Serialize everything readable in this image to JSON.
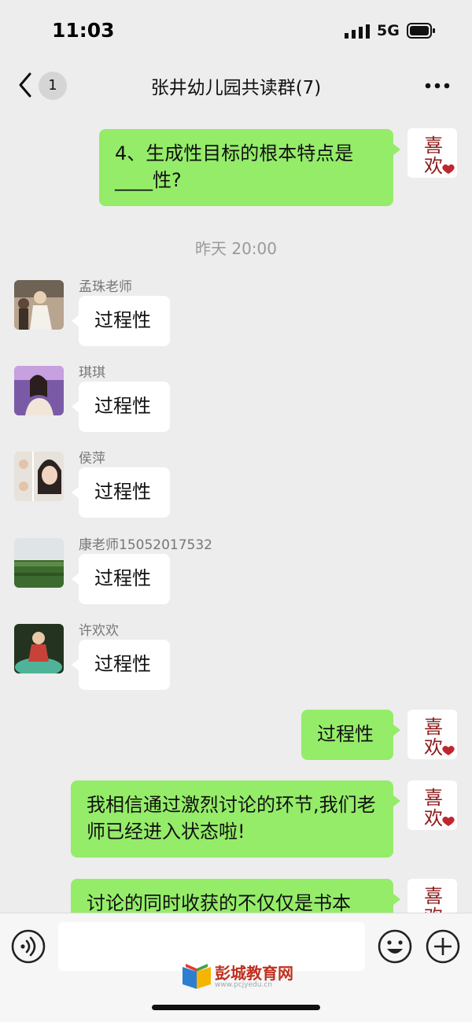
{
  "status_bar": {
    "time": "11:03",
    "network": "5G",
    "icons": [
      "signal-icon",
      "battery-icon"
    ]
  },
  "nav": {
    "back_icon": "chevron-left-icon",
    "unread_count": "1",
    "title": "张井幼儿园共读群(7)",
    "more_icon": "more-icon"
  },
  "messages": {
    "m1": {
      "text": "4、生成性目标的根本特点是____性?"
    },
    "timestamp": "昨天 20:00",
    "m2": {
      "sender": "孟珠老师",
      "text": "过程性"
    },
    "m3": {
      "sender": "琪琪",
      "text": "过程性"
    },
    "m4": {
      "sender": "侯萍",
      "text": "过程性"
    },
    "m5": {
      "sender": "康老师15052017532",
      "text": "过程性"
    },
    "m6": {
      "sender": "许欢欢",
      "text": "过程性"
    },
    "m7": {
      "text": "过程性"
    },
    "m8": {
      "text": "我相信通过激烈讨论的环节,我们老师已经进入状态啦!"
    },
    "m9": {
      "text": "讨论的同时收获的不仅仅是书本"
    }
  },
  "self_avatar": {
    "glyph_top": "喜",
    "glyph_bottom": "欢"
  },
  "input_bar": {
    "voice_icon": "voice-icon",
    "emoji_icon": "emoji-icon",
    "plus_icon": "plus-icon"
  },
  "watermark": {
    "name": "彭城教育网",
    "url": "www.pcjyedu.cn"
  },
  "colors": {
    "bubble_self": "#95ec69",
    "bubble_other": "#ffffff",
    "background": "#ededed"
  }
}
